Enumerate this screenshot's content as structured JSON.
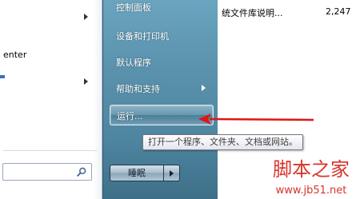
{
  "left_pane": {
    "items": [
      {
        "label": "",
        "has_arrow": true
      },
      {
        "label": "enter",
        "has_arrow": false
      },
      {
        "label": "",
        "has_arrow": true
      }
    ]
  },
  "search": {
    "value": "",
    "placeholder": ""
  },
  "right_pane": {
    "items": [
      {
        "label": "控制面板"
      },
      {
        "label": "设备和打印机"
      },
      {
        "label": "默认程序"
      },
      {
        "label": "帮助和支持"
      },
      {
        "label": "运行..."
      }
    ]
  },
  "power": {
    "sleep_label": "睡眠"
  },
  "background_file": {
    "name": "统文件库说明...",
    "size": "2,247"
  },
  "tooltip": {
    "text": "打开一个程序、文件夹、文档或网站。"
  },
  "watermark": {
    "brand": "脚本之家",
    "url": "www.jb51.net"
  },
  "colors": {
    "annotation_arrow": "#e01515",
    "watermark": "#d9342b"
  }
}
